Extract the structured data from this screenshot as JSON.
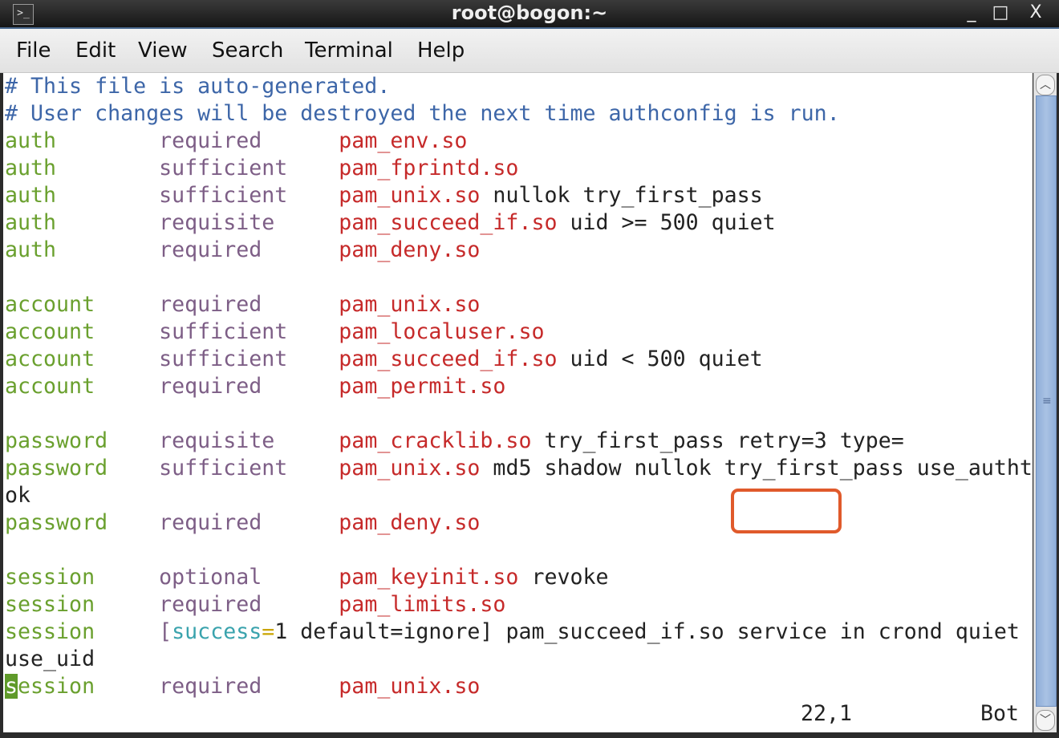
{
  "window": {
    "title": "root@bogon:~",
    "icon": "terminal-icon",
    "minimize": "_",
    "maximize": "□",
    "close": "X"
  },
  "menu": [
    "File",
    "Edit",
    "View",
    "Search",
    "Terminal",
    "Help"
  ],
  "colors": {
    "comment": "#3d66a8",
    "type": "#6aa02e",
    "control": "#7d5e86",
    "module": "#c62a2a",
    "highlight_box": "#e05a2b",
    "cursor": "#5f9a2a"
  },
  "lines": [
    [
      {
        "t": "# This file is auto-generated.",
        "c": "comment"
      }
    ],
    [
      {
        "t": "# User changes will be destroyed the next time authconfig is run.",
        "c": "comment"
      }
    ],
    [
      {
        "t": "auth        ",
        "c": "type"
      },
      {
        "t": "required      ",
        "c": "ctrl"
      },
      {
        "t": "pam_env.so",
        "c": "mod"
      }
    ],
    [
      {
        "t": "auth        ",
        "c": "type"
      },
      {
        "t": "sufficient    ",
        "c": "ctrl"
      },
      {
        "t": "pam_fprintd.so",
        "c": "mod"
      }
    ],
    [
      {
        "t": "auth        ",
        "c": "type"
      },
      {
        "t": "sufficient    ",
        "c": "ctrl"
      },
      {
        "t": "pam_unix.so",
        "c": "mod"
      },
      {
        "t": " nullok try_first_pass",
        "c": "text"
      }
    ],
    [
      {
        "t": "auth        ",
        "c": "type"
      },
      {
        "t": "requisite     ",
        "c": "ctrl"
      },
      {
        "t": "pam_succeed_if.so",
        "c": "mod"
      },
      {
        "t": " uid >= 500 quiet",
        "c": "text"
      }
    ],
    [
      {
        "t": "auth        ",
        "c": "type"
      },
      {
        "t": "required      ",
        "c": "ctrl"
      },
      {
        "t": "pam_deny.so",
        "c": "mod"
      }
    ],
    [],
    [
      {
        "t": "account     ",
        "c": "type"
      },
      {
        "t": "required      ",
        "c": "ctrl"
      },
      {
        "t": "pam_unix.so",
        "c": "mod"
      }
    ],
    [
      {
        "t": "account     ",
        "c": "type"
      },
      {
        "t": "sufficient    ",
        "c": "ctrl"
      },
      {
        "t": "pam_localuser.so",
        "c": "mod"
      }
    ],
    [
      {
        "t": "account     ",
        "c": "type"
      },
      {
        "t": "sufficient    ",
        "c": "ctrl"
      },
      {
        "t": "pam_succeed_if.so",
        "c": "mod"
      },
      {
        "t": " uid < 500 quiet",
        "c": "text"
      }
    ],
    [
      {
        "t": "account     ",
        "c": "type"
      },
      {
        "t": "required      ",
        "c": "ctrl"
      },
      {
        "t": "pam_permit.so",
        "c": "mod"
      }
    ],
    [],
    [
      {
        "t": "password    ",
        "c": "type"
      },
      {
        "t": "requisite     ",
        "c": "ctrl"
      },
      {
        "t": "pam_cracklib.so",
        "c": "mod"
      },
      {
        "t": " try_first_pass retry=3 type=",
        "c": "text"
      }
    ],
    [
      {
        "t": "password    ",
        "c": "type"
      },
      {
        "t": "sufficient    ",
        "c": "ctrl"
      },
      {
        "t": "pam_unix.so",
        "c": "mod"
      },
      {
        "t": " md5 shadow nullok try_first_pass use_autht",
        "c": "text"
      }
    ],
    [
      {
        "t": "ok",
        "c": "text"
      }
    ],
    [
      {
        "t": "password    ",
        "c": "type"
      },
      {
        "t": "required      ",
        "c": "ctrl"
      },
      {
        "t": "pam_deny.so",
        "c": "mod"
      }
    ],
    [],
    [
      {
        "t": "session     ",
        "c": "type"
      },
      {
        "t": "optional      ",
        "c": "ctrl"
      },
      {
        "t": "pam_keyinit.so",
        "c": "mod"
      },
      {
        "t": " revoke",
        "c": "text"
      }
    ],
    [
      {
        "t": "session     ",
        "c": "type"
      },
      {
        "t": "required      ",
        "c": "ctrl"
      },
      {
        "t": "pam_limits.so",
        "c": "mod"
      }
    ],
    [
      {
        "t": "session     ",
        "c": "type"
      },
      {
        "t": "[",
        "c": "ctrl"
      },
      {
        "t": "success",
        "c": "teal"
      },
      {
        "t": "=",
        "c": "yellow"
      },
      {
        "t": "1 default=ignore] pam_succeed_if.so service in crond quiet",
        "c": "text"
      }
    ],
    [
      {
        "t": "use_uid",
        "c": "text"
      }
    ],
    [
      {
        "t": "s",
        "c": "cursor"
      },
      {
        "t": "ession     ",
        "c": "type"
      },
      {
        "t": "required      ",
        "c": "ctrl"
      },
      {
        "t": "pam_unix.so",
        "c": "mod"
      }
    ]
  ],
  "status": {
    "position": "22,1",
    "scroll": "Bot"
  },
  "highlighted_text": "retry=3"
}
